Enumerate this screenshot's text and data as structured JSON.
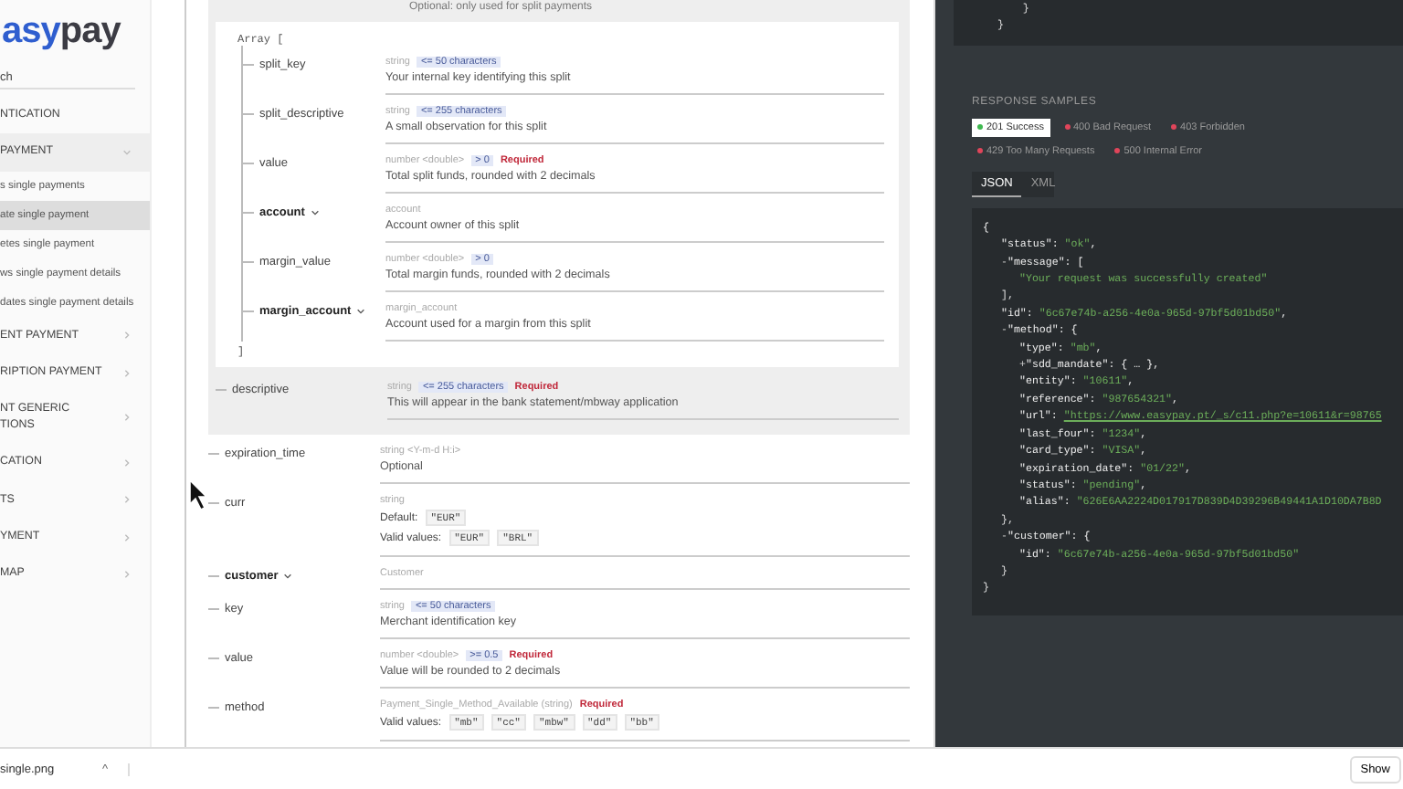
{
  "sidebar": {
    "logo": {
      "accent": "asy",
      "rest": "pay"
    },
    "search": {
      "placeholder": "ch"
    },
    "items": [
      {
        "label": "NTICATION",
        "kind": "link"
      },
      {
        "label": "PAYMENT",
        "kind": "group",
        "expanded": true,
        "children": [
          {
            "label": "s single payments",
            "selected": false
          },
          {
            "label": "ate single payment",
            "selected": true
          },
          {
            "label": "etes single payment",
            "selected": false
          },
          {
            "label": "ws single payment details",
            "selected": false
          },
          {
            "label": "dates single payment details",
            "selected": false
          }
        ]
      },
      {
        "label": "ENT PAYMENT",
        "kind": "group",
        "expanded": false
      },
      {
        "label": "RIPTION PAYMENT",
        "kind": "group",
        "expanded": false
      },
      {
        "label": "NT GENERIC\nTIONS",
        "kind": "group",
        "expanded": false
      },
      {
        "label": "CATION",
        "kind": "group",
        "expanded": false
      },
      {
        "label": "TS",
        "kind": "group",
        "expanded": false
      },
      {
        "label": "YMENT",
        "kind": "group",
        "expanded": false
      },
      {
        "label": "MAP",
        "kind": "group",
        "expanded": false
      }
    ]
  },
  "schema": {
    "split_note": "Optional: only used for split payments",
    "array_open": "Array [",
    "array_close": "]",
    "split_fields": [
      {
        "name": "split_key",
        "kind": "property",
        "type": "string",
        "constraint": "<= 50 characters",
        "description": "Your internal key identifying this split"
      },
      {
        "name": "split_descriptive",
        "kind": "property",
        "type": "string",
        "constraint": "<= 255 characters",
        "description": "A small observation for this split"
      },
      {
        "name": "value",
        "kind": "property",
        "type": "number <double>",
        "constraint": "> 0",
        "required": "Required",
        "description": "Total split funds, rounded with 2 decimals"
      },
      {
        "name": "account",
        "kind": "object",
        "type": "account",
        "description": "Account owner of this split"
      },
      {
        "name": "margin_value",
        "kind": "property",
        "type": "number <double>",
        "constraint": "> 0",
        "description": "Total margin funds, rounded with 2 decimals"
      },
      {
        "name": "margin_account",
        "kind": "object",
        "type": "margin_account",
        "description": "Account used for a margin from this split"
      }
    ],
    "split_tail": {
      "name": "descriptive",
      "type": "string",
      "constraint": "<= 255 characters",
      "required": "Required",
      "description": "This will appear in the bank statement/mbway application"
    },
    "fields": [
      {
        "name": "expiration_time",
        "kind": "property",
        "type": "string <Y-m-d H:i>",
        "description": "Optional"
      },
      {
        "name": "curr",
        "kind": "property",
        "type": "string",
        "default_label": "Default:",
        "default": "\"EUR\"",
        "valid_label": "Valid values:",
        "valid": [
          "\"EUR\"",
          "\"BRL\""
        ]
      },
      {
        "name": "customer",
        "kind": "object",
        "type": "Customer"
      },
      {
        "name": "key",
        "kind": "property",
        "type": "string",
        "constraint": "<= 50 characters",
        "description": "Merchant identification key"
      },
      {
        "name": "value",
        "kind": "property",
        "type": "number <double>",
        "constraint": ">= 0.5",
        "required": "Required",
        "description": "Value will be rounded to 2 decimals"
      },
      {
        "name": "method",
        "kind": "property",
        "type": "Payment_Single_Method_Available (string)",
        "required": "Required",
        "valid_label": "Valid values:",
        "valid": [
          "\"mb\"",
          "\"cc\"",
          "\"mbw\"",
          "\"dd\"",
          "\"bb\""
        ]
      }
    ]
  },
  "samples": {
    "top_code": [
      "    }",
      "}"
    ],
    "title": "RESPONSE SAMPLES",
    "responses": [
      {
        "label": "201 Success",
        "selected": true,
        "color": "#3fb950"
      },
      {
        "label": "400 Bad Request",
        "selected": false,
        "color": "#e0455a"
      },
      {
        "label": "403 Forbidden",
        "selected": false,
        "color": "#e0455a"
      },
      {
        "label": "429 Too Many Requests",
        "selected": false,
        "color": "#e0455a"
      },
      {
        "label": "500 Internal Error",
        "selected": false,
        "color": "#e0455a"
      }
    ],
    "formats": [
      {
        "label": "JSON",
        "selected": true
      },
      {
        "label": "XML",
        "selected": false
      }
    ],
    "code": {
      "open": "{",
      "close": "}",
      "children": [
        {
          "key": "\"status\": ",
          "value": "\"ok\"",
          "kind": "string",
          "punct": ","
        },
        {
          "toggle": "-",
          "key": "\"message\": ",
          "open": "[",
          "close": "],",
          "children": [
            {
              "value": "\"Your request was successfully created\"",
              "kind": "string"
            }
          ]
        },
        {
          "key": "\"id\": ",
          "value": "\"6c67e74b-a256-4e0a-965d-97bf5d01bd50\"",
          "kind": "string",
          "punct": ","
        },
        {
          "toggle": "-",
          "key": "\"method\": ",
          "open": "{",
          "close": "},",
          "children": [
            {
              "key": "\"type\": ",
              "value": "\"mb\"",
              "kind": "string",
              "punct": ","
            },
            {
              "toggle": "+",
              "key": "\"sdd_mandate\": ",
              "punct": "{ … },"
            },
            {
              "key": "\"entity\": ",
              "value": "\"10611\"",
              "kind": "string",
              "punct": ","
            },
            {
              "key": "\"reference\": ",
              "value": "\"987654321\"",
              "kind": "string",
              "punct": ","
            },
            {
              "key": "\"url\": ",
              "value": "\"https://www.easypay.pt/_s/c11.php?e=10611&r=98765",
              "kind": "link"
            },
            {
              "key": "\"last_four\": ",
              "value": "\"1234\"",
              "kind": "string",
              "punct": ","
            },
            {
              "key": "\"card_type\": ",
              "value": "\"VISA\"",
              "kind": "string",
              "punct": ","
            },
            {
              "key": "\"expiration_date\": ",
              "value": "\"01/22\"",
              "kind": "string",
              "punct": ","
            },
            {
              "key": "\"status\": ",
              "value": "\"pending\"",
              "kind": "string",
              "punct": ","
            },
            {
              "key": "\"alias\": ",
              "value": "\"626E6AA2224D017917D839D4D39296B49441A1D10DA7B8D",
              "kind": "string"
            }
          ]
        },
        {
          "toggle": "-",
          "key": "\"customer\": ",
          "open": "{",
          "close": "}",
          "children": [
            {
              "key": "\"id\": ",
              "value": "\"6c67e74b-a256-4e0a-965d-97bf5d01bd50\"",
              "kind": "string"
            }
          ]
        }
      ]
    }
  },
  "download_bar": {
    "file": "single.png",
    "caret": "^",
    "show_button": "Show"
  }
}
